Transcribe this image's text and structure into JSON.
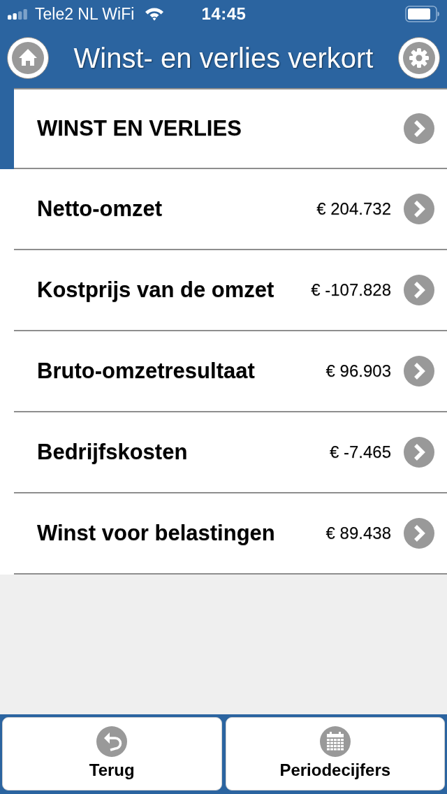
{
  "status_bar": {
    "carrier": "Tele2 NL WiFi",
    "time": "14:45"
  },
  "nav_bar": {
    "title": "Winst- en verlies verkort"
  },
  "rows": [
    {
      "kind": "header",
      "label": "WINST EN VERLIES"
    },
    {
      "kind": "item",
      "label": "Netto-omzet",
      "value": "€ 204.732"
    },
    {
      "kind": "item",
      "label": "Kostprijs van de omzet",
      "value": "€ -107.828"
    },
    {
      "kind": "item",
      "label": "Bruto-omzetresultaat",
      "value": "€ 96.903"
    },
    {
      "kind": "item",
      "label": "Bedrijfskosten",
      "value": "€ -7.465"
    },
    {
      "kind": "item",
      "label": "Winst voor belastingen",
      "value": "€ 89.438"
    }
  ],
  "footer": {
    "back_button": {
      "label": "Terug"
    },
    "period_button": {
      "label": "Periodecijfers"
    }
  }
}
